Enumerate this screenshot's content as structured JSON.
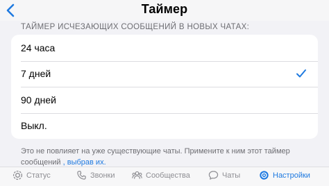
{
  "header": {
    "title": "Таймер"
  },
  "section": {
    "title": "ТАЙМЕР ИСЧЕЗАЮЩИХ СООБЩЕНИЙ В НОВЫХ ЧАТАХ:"
  },
  "options": [
    {
      "label": "24 часа",
      "selected": false
    },
    {
      "label": "7 дней",
      "selected": true
    },
    {
      "label": "90 дней",
      "selected": false
    },
    {
      "label": "Выкл.",
      "selected": false
    }
  ],
  "footer": {
    "line1": "Это не повлияет на уже существующие чаты. Примените к ним этот таймер",
    "line2_prefix": "сообщений ",
    "line2_link": ", выбрав их."
  },
  "tabs": [
    {
      "label": "Статус",
      "icon": "status-icon"
    },
    {
      "label": "Звонки",
      "icon": "phone-icon"
    },
    {
      "label": "Сообщества",
      "icon": "communities-icon"
    },
    {
      "label": "Чаты",
      "icon": "chats-icon"
    },
    {
      "label": "Настройки",
      "icon": "settings-icon",
      "active": true
    }
  ],
  "colors": {
    "accent": "#1f7ae0",
    "background": "#f2f2f6",
    "secondary_text": "#6d6d72"
  }
}
